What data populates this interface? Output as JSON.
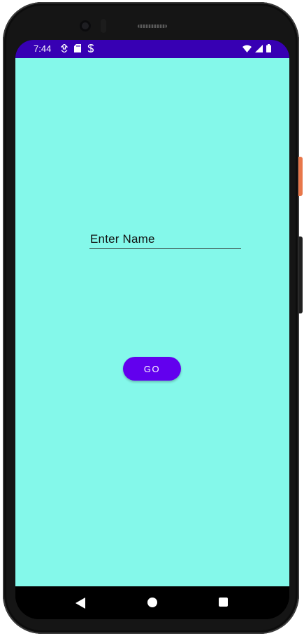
{
  "status_bar": {
    "time": "7:44",
    "background_color": "#3700b3",
    "left_icons": [
      "download-notification-icon",
      "sd-card-icon",
      "s-app-icon"
    ],
    "right_icons": [
      "wifi-icon",
      "cell-signal-icon",
      "battery-icon"
    ]
  },
  "screen": {
    "background_color": "#84f8ea"
  },
  "name_input": {
    "placeholder": "Enter Name",
    "value": ""
  },
  "go_button": {
    "label": "GO",
    "color": "#6200ee"
  },
  "nav_bar": {
    "icons": [
      "back-icon",
      "home-icon",
      "recents-icon"
    ]
  }
}
